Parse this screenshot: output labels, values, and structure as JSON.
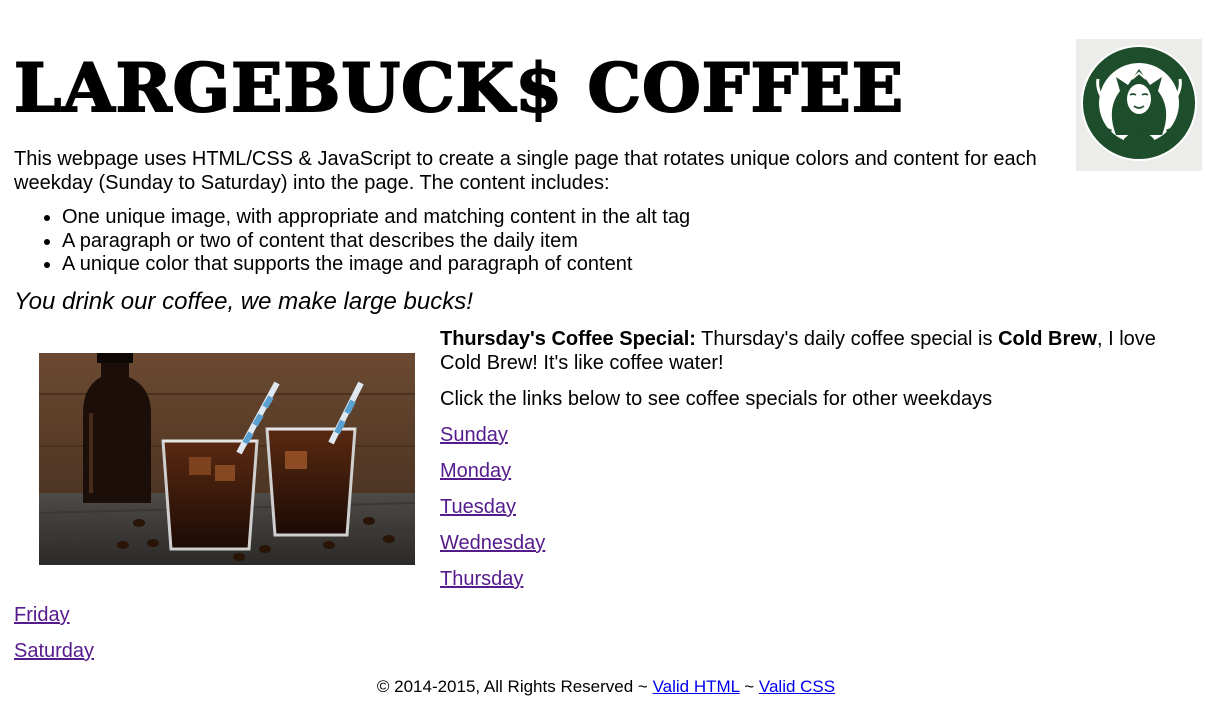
{
  "header": {
    "title": "LARGEBUCK$ COFFEE",
    "logo_icon": "siren-logo-icon"
  },
  "intro": "This webpage uses HTML/CSS & JavaScript to create a single page that rotates unique colors and content for each weekday (Sunday to Saturday) into the page. The content includes:",
  "features": [
    "One unique image, with appropriate and matching content in the alt tag",
    "A paragraph or two of content that describes the daily item",
    "A unique color that supports the image and paragraph of content"
  ],
  "tagline": "You drink our coffee, we make large bucks!",
  "special": {
    "label": "Thursday's Coffee Special:",
    "text_before": " Thursday's daily coffee special is ",
    "drink": "Cold Brew",
    "text_after": ", I love Cold Brew! It's like coffee water!",
    "image_alt": "Cold Brew"
  },
  "hint": "Click the links below to see coffee specials for other weekdays",
  "days": [
    "Sunday",
    "Monday",
    "Tuesday",
    "Wednesday",
    "Thursday",
    "Friday",
    "Saturday"
  ],
  "footer": {
    "copyright": "© 2014-2015, All Rights Reserved ~ ",
    "separator": " ~ ",
    "valid_html": "Valid HTML",
    "valid_css": "Valid CSS"
  },
  "colors": {
    "link_visited": "#551a8b",
    "link": "#0000ee",
    "logo_green": "#1e4d2b"
  }
}
